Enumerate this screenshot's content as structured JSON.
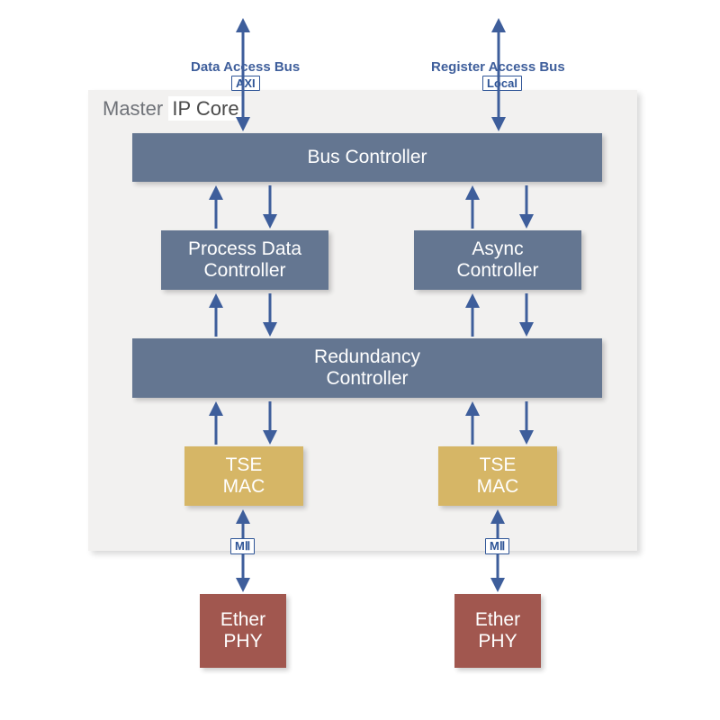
{
  "title": {
    "a": "Master",
    "b": "IP Core"
  },
  "top": {
    "data_bus": "Data Access Bus",
    "axi": "AXI",
    "reg_bus": "Register Access Bus",
    "local": "Local"
  },
  "blocks": {
    "bus": "Bus Controller",
    "pdc1": "Process Data",
    "pdc2": "Controller",
    "async1": "Async",
    "async2": "Controller",
    "red1": "Redundancy",
    "red2": "Controller",
    "tse_a1": "TSE",
    "tse_a2": "MAC",
    "tse_b1": "TSE",
    "tse_b2": "MAC",
    "phy_a1": "Ether",
    "phy_a2": "PHY",
    "phy_b1": "Ether",
    "phy_b2": "PHY"
  },
  "mii": {
    "a": "MⅡ",
    "b": "MⅡ"
  }
}
